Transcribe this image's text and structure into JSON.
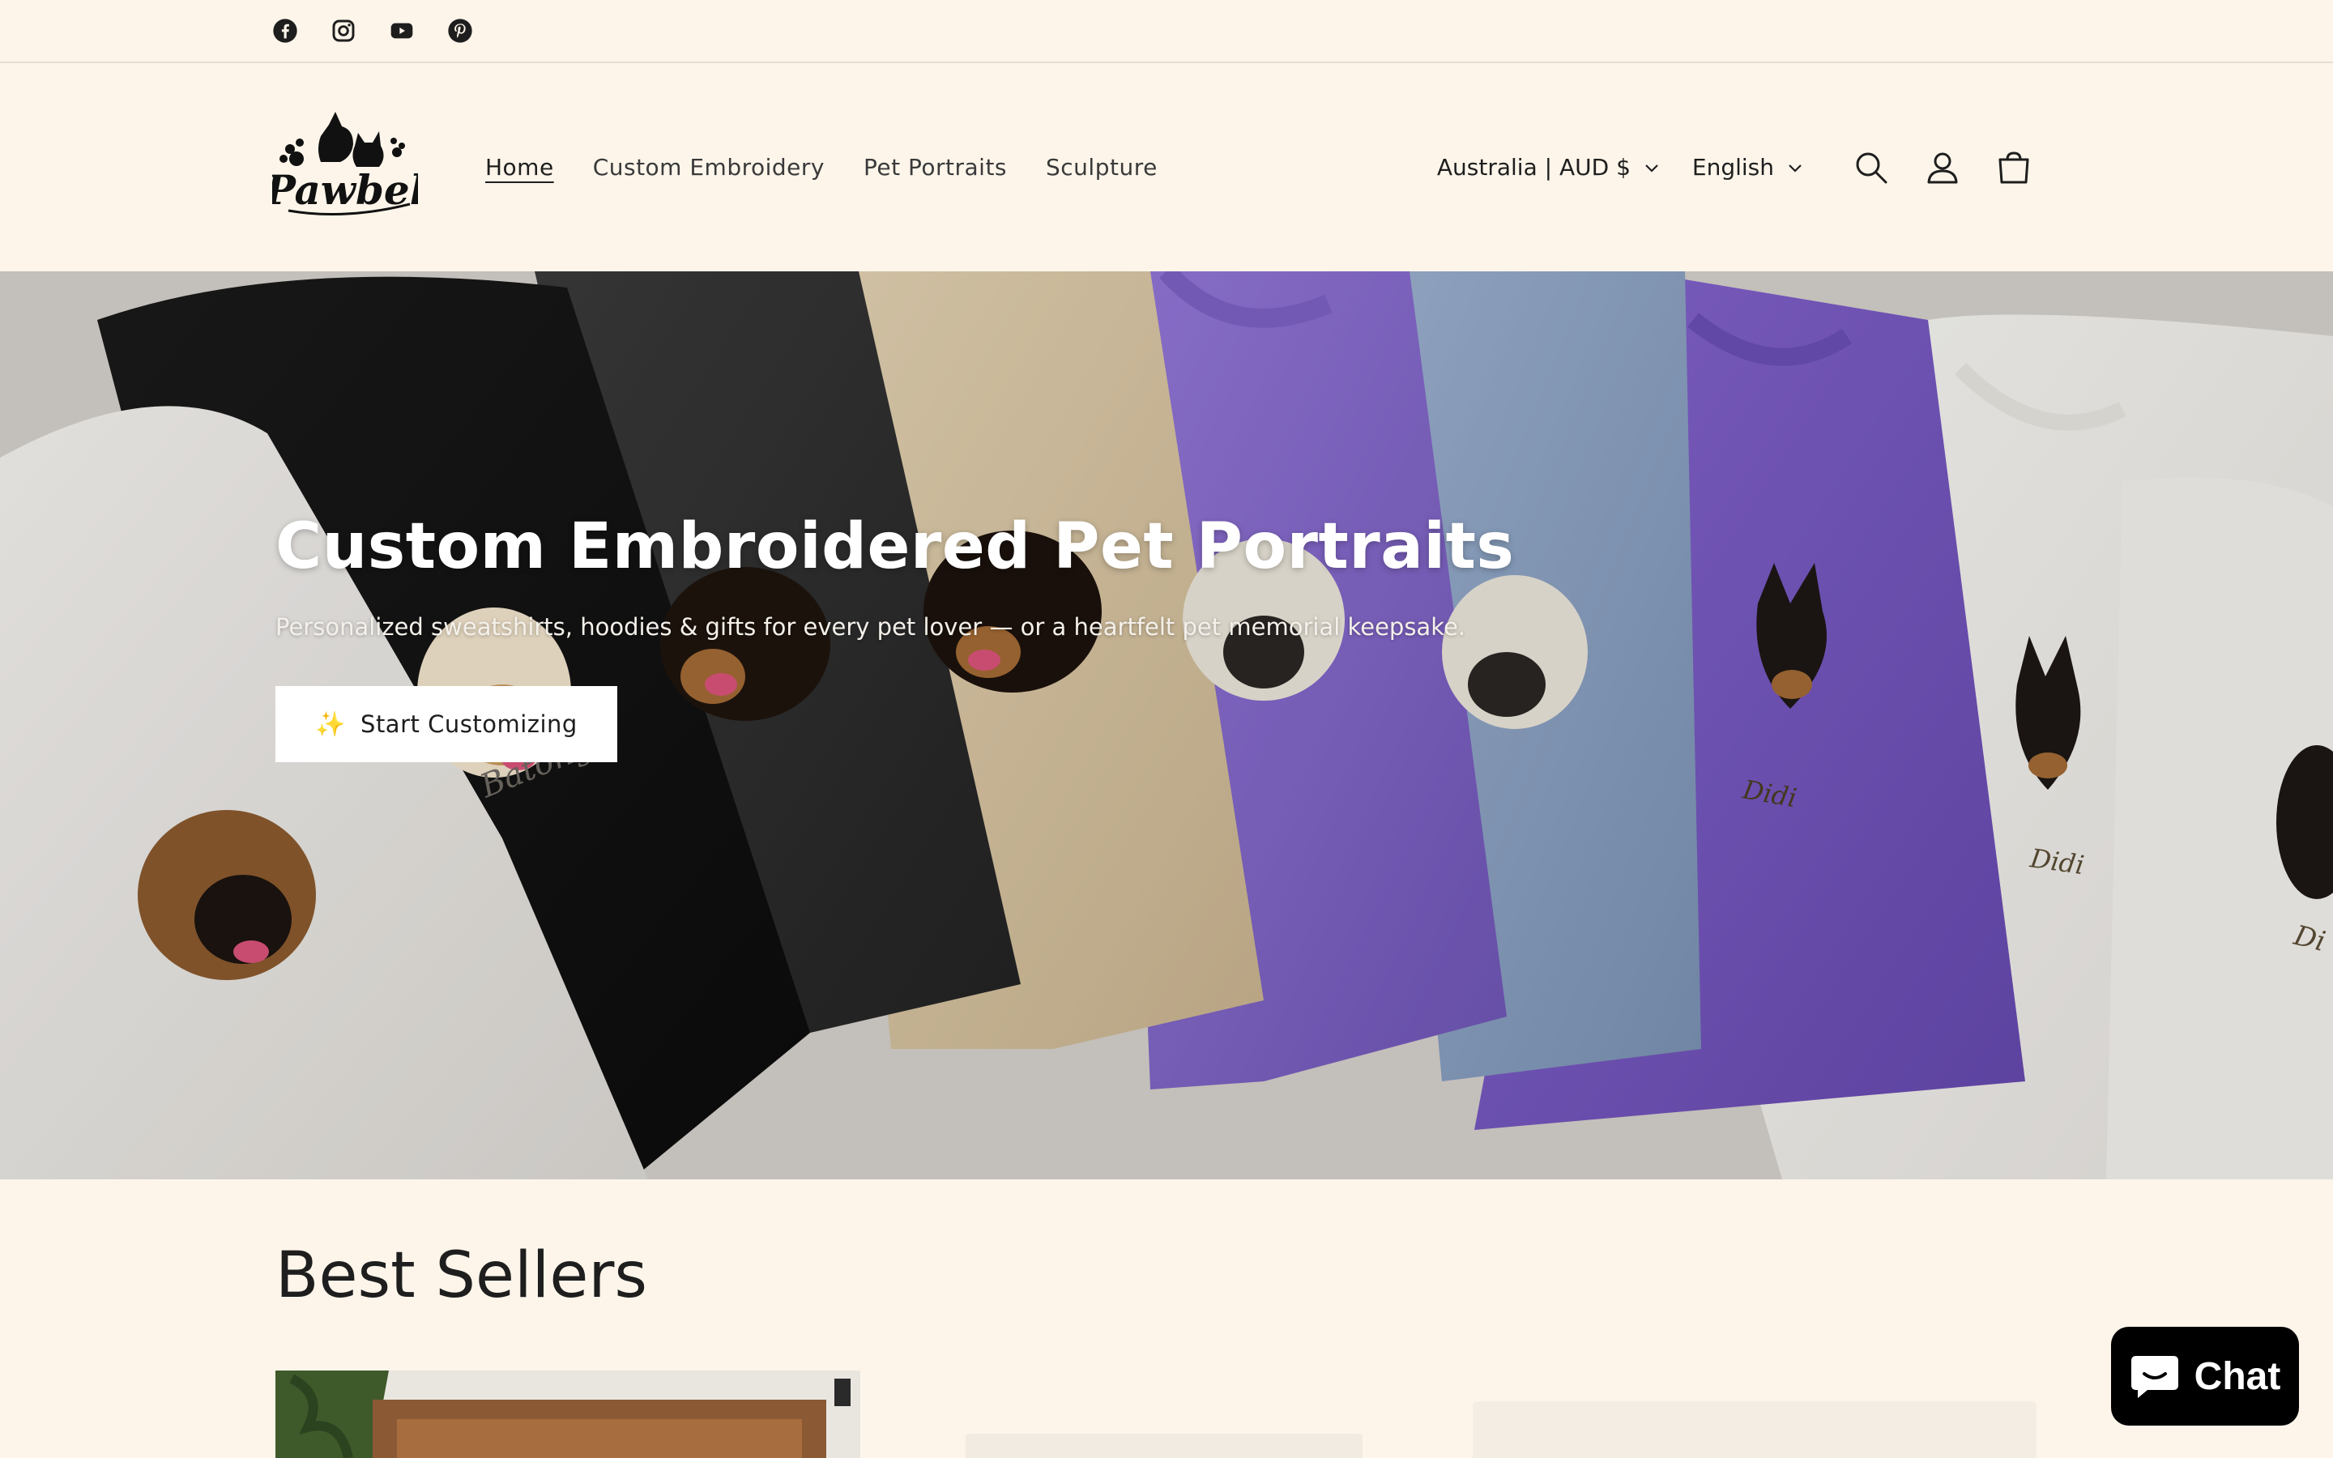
{
  "social": {
    "items": [
      {
        "name": "facebook",
        "icon": "facebook-icon"
      },
      {
        "name": "instagram",
        "icon": "instagram-icon"
      },
      {
        "name": "youtube",
        "icon": "youtube-icon"
      },
      {
        "name": "pinterest",
        "icon": "pinterest-icon"
      }
    ]
  },
  "header": {
    "logo_text": "Pawbel",
    "nav": [
      {
        "label": "Home",
        "active": true
      },
      {
        "label": "Custom Embroidery",
        "active": false
      },
      {
        "label": "Pet Portraits",
        "active": false
      },
      {
        "label": "Sculpture",
        "active": false
      }
    ],
    "country_selector": "Australia | AUD $",
    "language_selector": "English",
    "icons": [
      "search-icon",
      "account-icon",
      "cart-icon"
    ]
  },
  "hero": {
    "title": "Custom Embroidered Pet Portraits",
    "subtitle": "Personalized sweatshirts, hoodies & gifts for every pet lover — or a heartfelt pet memorial keepsake.",
    "cta_icon": "✨",
    "cta_label": "Start Customizing",
    "embroidered_names": [
      "Batong",
      "Didi",
      "Didi",
      "Di"
    ]
  },
  "best_sellers": {
    "title": "Best Sellers"
  },
  "chat": {
    "label": "Chat"
  },
  "colors": {
    "page_bg": "#fdf5ea",
    "text": "#1e1e1e",
    "chat_bg": "#000000",
    "sweater_purple": "#8a6cd1",
    "sweater_blue": "#8ea5c6",
    "sweater_tan": "#dbc6a3"
  }
}
